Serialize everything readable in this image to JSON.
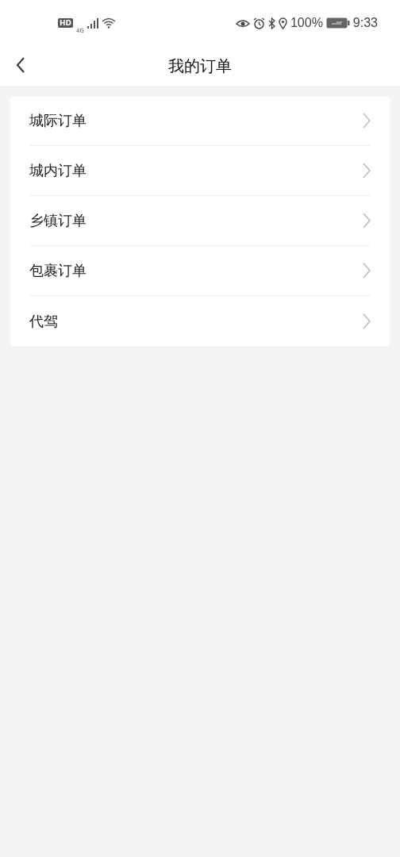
{
  "status_bar": {
    "hd_badge": "HD",
    "network": "4G",
    "battery_percent": "100%",
    "time": "9:33"
  },
  "header": {
    "title": "我的订单"
  },
  "menu_items": [
    {
      "label": "城际订单"
    },
    {
      "label": "城内订单"
    },
    {
      "label": "乡镇订单"
    },
    {
      "label": "包裹订单"
    },
    {
      "label": "代驾"
    }
  ]
}
